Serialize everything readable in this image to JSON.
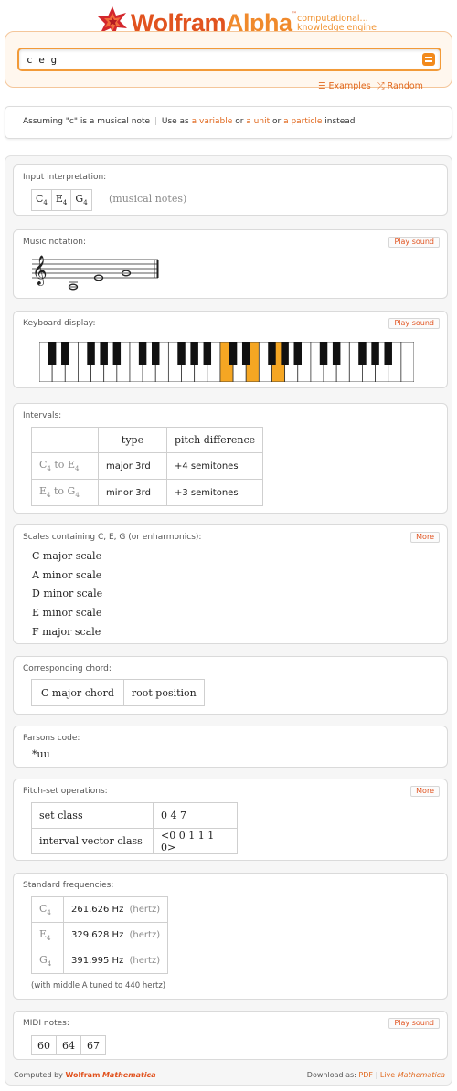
{
  "header": {
    "logo_word1": "Wolfram",
    "logo_word2": "Alpha",
    "tm": "™",
    "tagline1": "computational...",
    "tagline2": "knowledge engine",
    "brand_color": "#e1531f"
  },
  "search": {
    "value": "c e g",
    "equals_icon": "equals-icon"
  },
  "links": {
    "examples": "Examples",
    "random": "Random"
  },
  "assumption": {
    "prefix": "Assuming \"c\" is a musical note",
    "separator": "|",
    "use_as": "Use as",
    "option1": "a variable",
    "or1": "or",
    "option2": "a unit",
    "or2": "or",
    "option3": "a particle",
    "suffix": "instead"
  },
  "pods": {
    "input": {
      "title": "Input interpretation:",
      "notes": [
        {
          "letter": "C",
          "octave": "4"
        },
        {
          "letter": "E",
          "octave": "4"
        },
        {
          "letter": "G",
          "octave": "4"
        }
      ],
      "note_kind": "(musical notes)"
    },
    "notation": {
      "title": "Music notation:",
      "button": "Play sound"
    },
    "keyboard": {
      "title": "Keyboard display:",
      "button": "Play sound",
      "highlight_color": "#f5a623"
    },
    "intervals": {
      "title": "Intervals:",
      "headers": [
        "type",
        "pitch difference"
      ],
      "rows": [
        {
          "from": "C",
          "from_oct": "4",
          "to_word": "to",
          "to": "E",
          "to_oct": "4",
          "type": "major 3rd",
          "diff": "+4 semitones"
        },
        {
          "from": "E",
          "from_oct": "4",
          "to_word": "to",
          "to": "G",
          "to_oct": "4",
          "type": "minor 3rd",
          "diff": "+3 semitones"
        }
      ]
    },
    "scales": {
      "title": "Scales containing C, E, G (or enharmonics):",
      "button": "More",
      "items": [
        "C major scale",
        "A minor scale",
        "D minor scale",
        "E minor scale",
        "F major scale"
      ]
    },
    "chord": {
      "title": "Corresponding chord:",
      "name": "C major chord",
      "position": "root position"
    },
    "parsons": {
      "title": "Parsons code:",
      "code": "*uu"
    },
    "pitchset": {
      "title": "Pitch-set operations:",
      "button": "More",
      "rows": [
        {
          "label": "set class",
          "value": "0 4 7"
        },
        {
          "label": "interval vector class",
          "value": "<0 0 1 1 1 0>"
        }
      ]
    },
    "frequencies": {
      "title": "Standard frequencies:",
      "unit": "Hz",
      "unit_word": "(hertz)",
      "rows": [
        {
          "note": "C",
          "oct": "4",
          "freq": "261.626"
        },
        {
          "note": "E",
          "oct": "4",
          "freq": "329.628"
        },
        {
          "note": "G",
          "oct": "4",
          "freq": "391.995"
        }
      ],
      "footnote": "(with middle A tuned to 440 hertz)"
    },
    "midi": {
      "title": "MIDI notes:",
      "button": "Play sound",
      "values": [
        "60",
        "64",
        "67"
      ]
    }
  },
  "footer": {
    "computed_by": "Computed by",
    "brand": "Wolfram",
    "brand2": "Mathematica",
    "download_as": "Download as:",
    "pdf": "PDF",
    "sep": "|",
    "live": "Live",
    "live2": "Mathematica"
  }
}
